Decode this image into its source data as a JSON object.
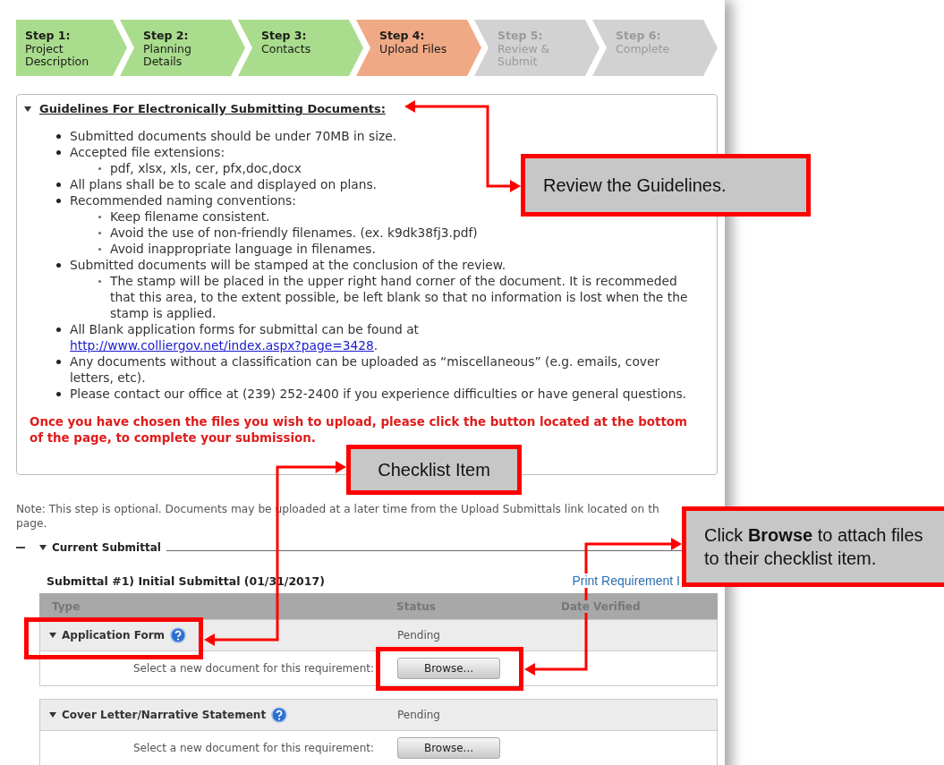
{
  "steps": [
    {
      "label": "Step 1:",
      "sublabel_lines": [
        "Project",
        "Description"
      ],
      "completed": true,
      "selected": false
    },
    {
      "label": "Step 2:",
      "sublabel_lines": [
        "Planning",
        "Details"
      ],
      "completed": true,
      "selected": false
    },
    {
      "label": "Step 3:",
      "sublabel_lines": [
        "Contacts"
      ],
      "completed": true,
      "selected": false
    },
    {
      "label": "Step 4:",
      "sublabel_lines": [
        "Upload Files"
      ],
      "completed": false,
      "selected": true
    },
    {
      "label": "Step 5:",
      "sublabel_lines": [
        "Review &",
        "Submit"
      ],
      "completed": false,
      "selected": false
    },
    {
      "label": "Step 6:",
      "sublabel_lines": [
        "Complete"
      ],
      "completed": false,
      "selected": false
    }
  ],
  "guidelines": {
    "title": "Guidelines For Electronically Submitting Documents:",
    "items": [
      {
        "text": "Submitted documents should be under 70MB in size."
      },
      {
        "text": "Accepted file extensions:",
        "children": [
          {
            "text": "pdf, xlsx, xls, cer, pfx,doc,docx"
          }
        ]
      },
      {
        "text": "All plans shall be to scale and displayed on plans."
      },
      {
        "text": "Recommended naming conventions:",
        "children": [
          {
            "text": "Keep filename consistent."
          },
          {
            "text": "Avoid the use of non-friendly filenames. (ex. k9dk38fj3.pdf)"
          },
          {
            "text": "Avoid inappropriate language in filenames."
          }
        ]
      },
      {
        "text": "Submitted documents will be stamped at the conclusion of the review.",
        "children": [
          {
            "text": "The stamp will be placed in the upper right hand corner of the document. It is recommeded that this area, to the extent possible, be left blank so that no information is lost when the the stamp is applied."
          }
        ]
      },
      {
        "text": "All Blank application forms for submittal can be found at ",
        "link": "http://www.colliergov.net/index.aspx?page=3428",
        "after": "."
      },
      {
        "text": "Any documents without a classification can be uploaded as “miscellaneous” (e.g. emails, cover letters, etc)."
      },
      {
        "text": "Please contact our office at (239) 252-2400 if you experience difficulties or have general questions."
      }
    ],
    "warning": "Once you have chosen the files you wish to upload, please click the button located at the bottom of the page, to complete your submission."
  },
  "note_lines": [
    "Note: This step is optional. Documents may be uploaded at a later time from the Upload Submittals link located on th",
    "page."
  ],
  "current_submittal": {
    "legend": "Current Submittal",
    "title": "Submittal #1) Initial Submittal (01/31/2017)",
    "print_link": "Print Requirement I",
    "columns": [
      "Type",
      "Status",
      "Date Verified"
    ],
    "requirements": [
      {
        "name": "Application Form",
        "status": "Pending",
        "prompt": "Select a new document for this requirement:",
        "button": "Browse..."
      },
      {
        "name": "Cover Letter/Narrative Statement",
        "status": "Pending",
        "prompt": "Select a new document for this requirement:",
        "button": "Browse..."
      }
    ]
  },
  "callouts": [
    {
      "kind": "guidelines",
      "text": "Review the Guidelines."
    },
    {
      "kind": "checklist",
      "text": "Checklist Item"
    },
    {
      "kind": "browse",
      "text": "Click **Browse** to attach files to their checklist item."
    }
  ]
}
